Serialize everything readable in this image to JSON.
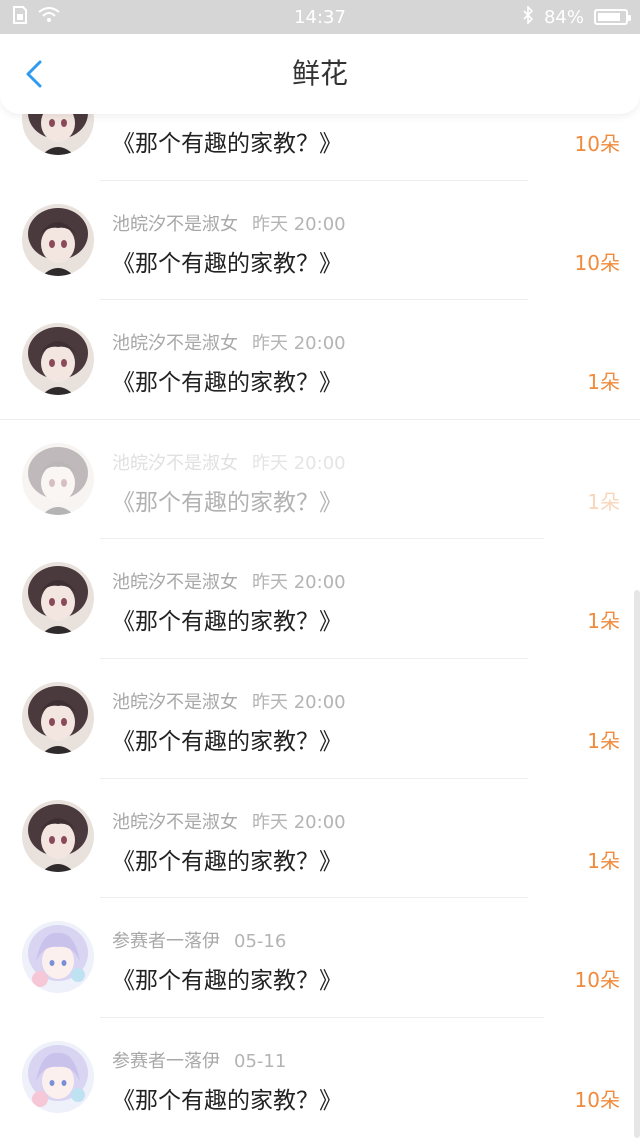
{
  "status_bar": {
    "time": "14:37",
    "battery": "84%",
    "battery_level": 0.84
  },
  "header": {
    "title": "鲜花"
  },
  "items": [
    {
      "user": "",
      "time": "",
      "title": "《那个有趣的家教？》",
      "count": "10朵",
      "avatar": "brown-hair"
    },
    {
      "user": "池皖汐不是淑女",
      "time": "昨天 20:00",
      "title": "《那个有趣的家教？》",
      "count": "10朵",
      "avatar": "brown-hair"
    },
    {
      "user": "池皖汐不是淑女",
      "time": "昨天 20:00",
      "title": "《那个有趣的家教？》",
      "count": "1朵",
      "avatar": "brown-hair"
    },
    {
      "user": "池皖汐不是淑女",
      "time": "昨天 20:00",
      "title": "《那个有趣的家教？》",
      "count": "1朵",
      "avatar": "brown-hair"
    },
    {
      "user": "池皖汐不是淑女",
      "time": "昨天 20:00",
      "title": "《那个有趣的家教？》",
      "count": "1朵",
      "avatar": "brown-hair"
    },
    {
      "user": "池皖汐不是淑女",
      "time": "昨天 20:00",
      "title": "《那个有趣的家教？》",
      "count": "1朵",
      "avatar": "brown-hair"
    },
    {
      "user": "池皖汐不是淑女",
      "time": "昨天 20:00",
      "title": "《那个有趣的家教？》",
      "count": "1朵",
      "avatar": "brown-hair"
    },
    {
      "user": "参赛者一落伊",
      "time": "05-16",
      "title": "《那个有趣的家教？》",
      "count": "10朵",
      "avatar": "pastel-hair"
    },
    {
      "user": "参赛者一落伊",
      "time": "05-11",
      "title": "《那个有趣的家教？》",
      "count": "10朵",
      "avatar": "pastel-hair"
    }
  ],
  "colors": {
    "accent": "#f08a3c",
    "back": "#2f9bf0"
  }
}
